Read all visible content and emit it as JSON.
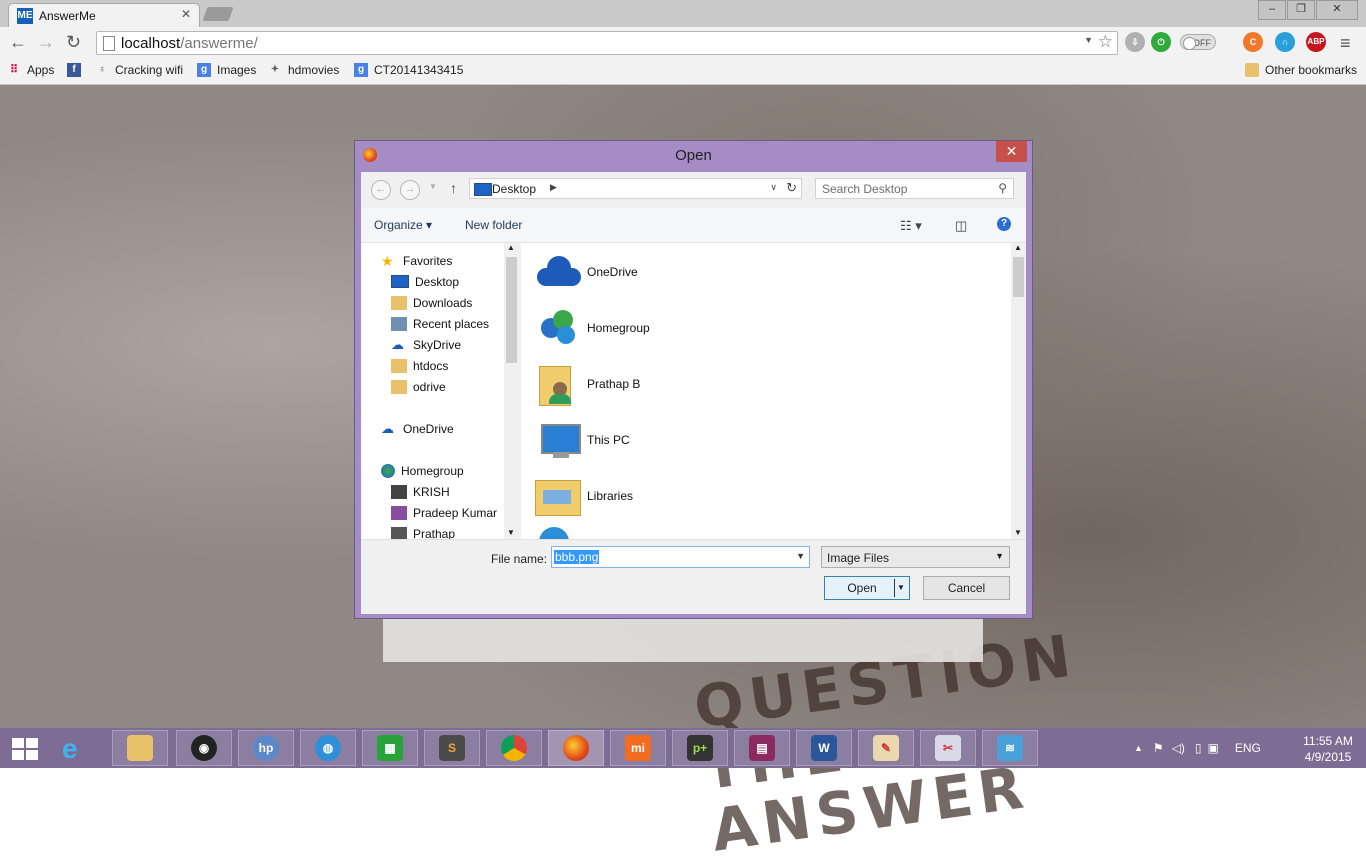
{
  "browser": {
    "tab_title": "AnswerMe",
    "tab_favicon_text": "ME",
    "url_host": "localhost",
    "url_path": "/answerme/",
    "toggle_label": "OFF",
    "ext_abp": "ABP",
    "bookmarks": [
      {
        "label": "Apps",
        "icon": "apps-grid-icon"
      },
      {
        "label": "Cracking wifi",
        "icon": "wifi-page-icon"
      },
      {
        "label": "Images",
        "icon": "google-icon"
      },
      {
        "label": "hdmovies",
        "icon": "movie-icon"
      },
      {
        "label": "CT20141343415",
        "icon": "google-icon"
      }
    ],
    "facebook_icon": "f",
    "other_bookmarks": "Other bookmarks"
  },
  "page": {
    "stencil_line1": "QUESTION",
    "stencil_line2": "THE ANSWER"
  },
  "dialog": {
    "title": "Open",
    "address": "Desktop",
    "search_placeholder": "Search Desktop",
    "organize": "Organize",
    "new_folder": "New folder",
    "nav": {
      "favorites_label": "Favorites",
      "favorites": [
        "Desktop",
        "Downloads",
        "Recent places",
        "SkyDrive",
        "htdocs",
        "odrive"
      ],
      "onedrive": "OneDrive",
      "homegroup": "Homegroup",
      "homegroup_members": [
        "KRISH",
        "Pradeep Kumar",
        "Prathap"
      ]
    },
    "files": [
      "OneDrive",
      "Homegroup",
      "Prathap B",
      "This PC",
      "Libraries"
    ],
    "file_name_label": "File name:",
    "file_name_value": "bbb.png",
    "file_type": "Image Files",
    "open_button": "Open",
    "cancel_button": "Cancel"
  },
  "taskbar": {
    "language": "ENG",
    "time": "11:55 AM",
    "date": "4/9/2015",
    "apps": [
      "file-explorer-icon",
      "webcam-icon",
      "hp-icon",
      "globe-icon",
      "store-icon",
      "sublime-icon",
      "chrome-icon",
      "firefox-icon",
      "mi-icon",
      "pplus-icon",
      "winrar-icon",
      "word-icon",
      "paint-icon",
      "snipping-icon",
      "wifi-icon"
    ]
  }
}
